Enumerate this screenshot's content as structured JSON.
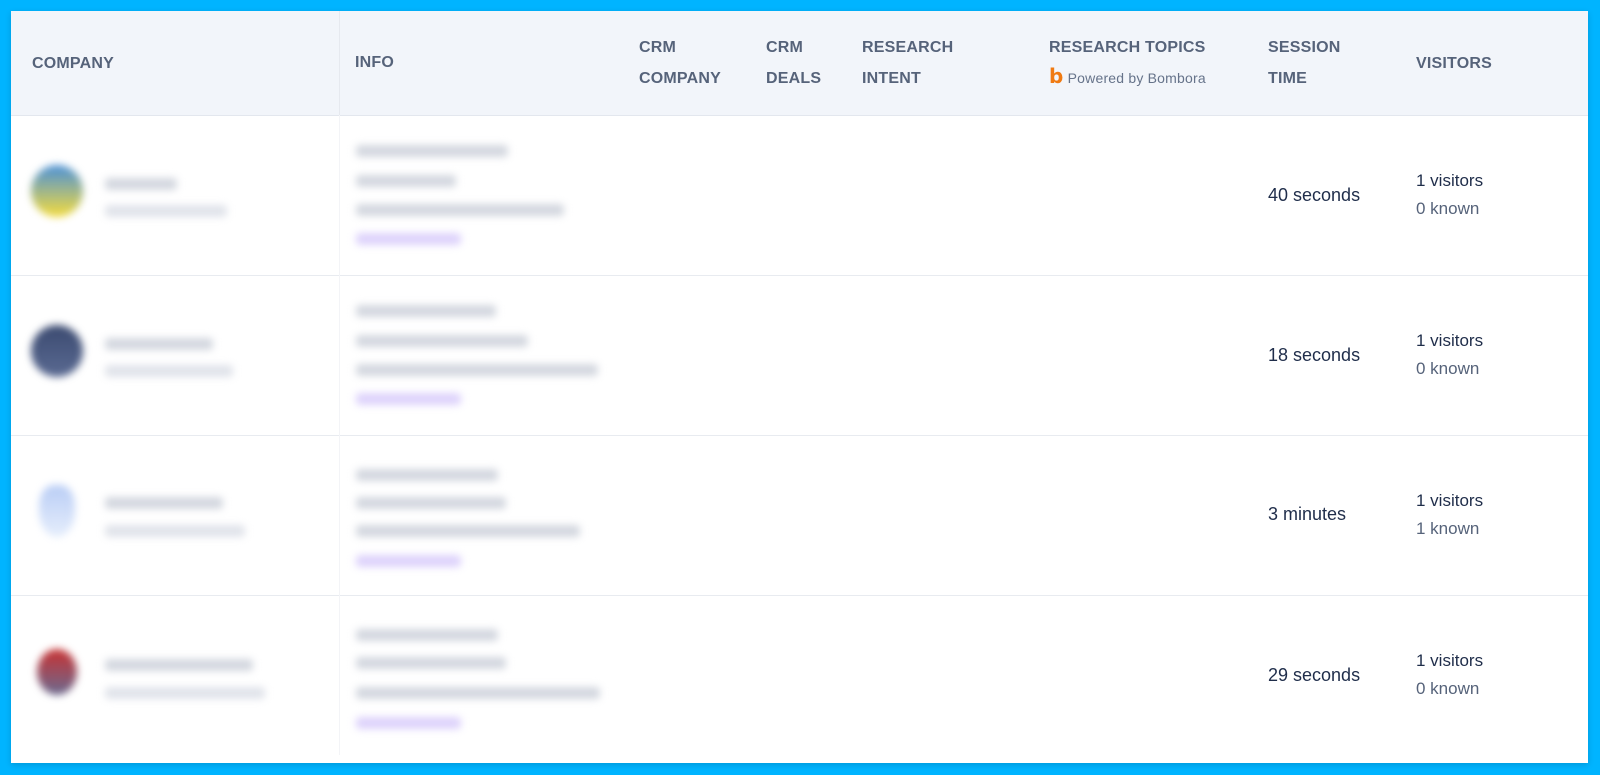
{
  "table": {
    "columns": [
      {
        "key": "company",
        "label_lines": [
          "COMPANY"
        ]
      },
      {
        "key": "info",
        "label_lines": [
          "INFO"
        ]
      },
      {
        "key": "crm_company",
        "label_lines": [
          "CRM",
          "COMPANY"
        ]
      },
      {
        "key": "crm_deals",
        "label_lines": [
          "CRM",
          "DEALS"
        ]
      },
      {
        "key": "research_intent",
        "label_lines": [
          "RESEARCH",
          "INTENT"
        ]
      },
      {
        "key": "research_topics",
        "label_lines": [
          "RESEARCH TOPICS"
        ],
        "sublabel": "Powered by Bombora",
        "sublabel_icon": "bombora-logo-icon"
      },
      {
        "key": "session_time",
        "label_lines": [
          "SESSION",
          "TIME"
        ]
      },
      {
        "key": "visitors",
        "label_lines": [
          "VISITORS"
        ]
      }
    ],
    "rows": [
      {
        "company": "[redacted]",
        "info": "[redacted]",
        "avatar_colors": [
          "#4a90d9",
          "#f5dc3c"
        ],
        "session_time": "40 seconds",
        "visitors": "1 visitors",
        "known": "0 known"
      },
      {
        "company": "[redacted]",
        "info": "[redacted]",
        "avatar_colors": [
          "#3b4a70",
          "#5a6a92"
        ],
        "session_time": "18 seconds",
        "visitors": "1 visitors",
        "known": "0 known"
      },
      {
        "company": "[redacted]",
        "info": "[redacted]",
        "avatar_colors": [
          "#b9cdf5",
          "#e6eefc"
        ],
        "session_time": "3 minutes",
        "visitors": "1 visitors",
        "known": "1 known"
      },
      {
        "company": "[redacted]",
        "info": "[redacted]",
        "avatar_colors": [
          "#c83232",
          "#6a6a90"
        ],
        "session_time": "29 seconds",
        "visitors": "1 visitors",
        "known": "0 known"
      }
    ]
  },
  "colors": {
    "frame": "#00b4ff",
    "header_bg": "#f2f5fa",
    "header_text": "#56637a",
    "bombora_orange": "#f07a12",
    "link_purple": "#8b5cf6"
  }
}
